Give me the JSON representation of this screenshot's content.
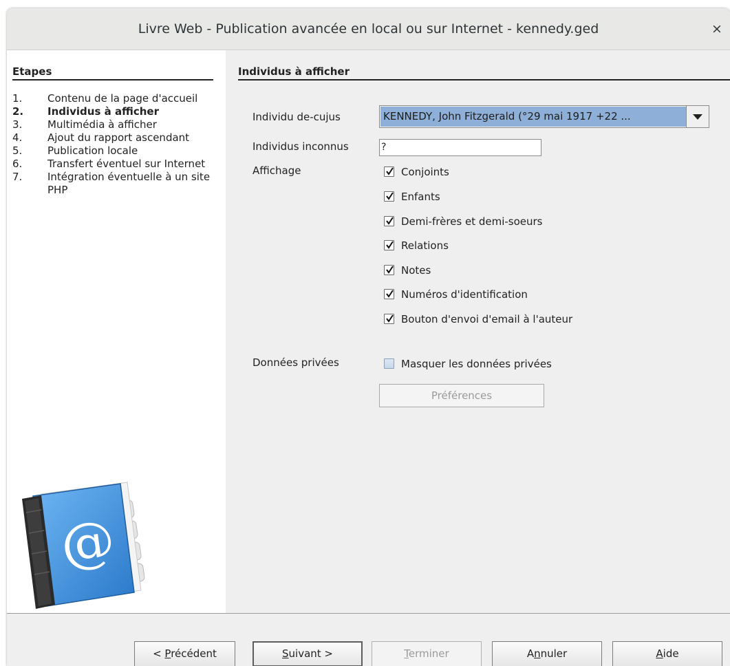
{
  "window": {
    "title": "Livre Web - Publication avancée en local ou sur Internet - kennedy.ged",
    "close_glyph": "×"
  },
  "steps": {
    "title": "Etapes",
    "items": [
      {
        "num": "1.",
        "label": "Contenu de la page d'accueil",
        "active": false
      },
      {
        "num": "2.",
        "label": "Individus à afficher",
        "active": true
      },
      {
        "num": "3.",
        "label": "Multimédia à afficher",
        "active": false
      },
      {
        "num": "4.",
        "label": "Ajout du rapport ascendant",
        "active": false
      },
      {
        "num": "5.",
        "label": "Publication locale",
        "active": false
      },
      {
        "num": "6.",
        "label": "Transfert éventuel sur Internet",
        "active": false
      },
      {
        "num": "7.",
        "label": "Intégration éventuelle à un site PHP",
        "active": false
      }
    ],
    "illustration_icon": "address-book-icon",
    "illustration_glyph": "@"
  },
  "section": {
    "title": "Individus à afficher",
    "decujus_label": "Individu de-cujus",
    "decujus_value": "KENNEDY, John Fitzgerald (°29 mai 1917 +22 ...",
    "inconnus_label": "Individus inconnus",
    "inconnus_value": "?",
    "affichage_label": "Affichage",
    "options": [
      {
        "label": "Conjoints",
        "checked": true
      },
      {
        "label": "Enfants",
        "checked": true
      },
      {
        "label": "Demi-frères et demi-soeurs",
        "checked": true
      },
      {
        "label": "Relations",
        "checked": true
      },
      {
        "label": "Notes",
        "checked": true
      },
      {
        "label": "Numéros d'identification",
        "checked": true
      },
      {
        "label": "Bouton d'envoi d'email à l'auteur",
        "checked": true
      }
    ],
    "privees_label": "Données privées",
    "masquer_label": "Masquer les données privées",
    "masquer_checked": false,
    "preferences_label": "Préférences"
  },
  "buttons": {
    "precedent": {
      "pre": "< ",
      "key": "P",
      "post": "récédent"
    },
    "suivant": {
      "pre": "",
      "key": "S",
      "post": "uivant >"
    },
    "terminer": {
      "pre": "",
      "key": "T",
      "post": "erminer"
    },
    "annuler": {
      "pre": "A",
      "key": "n",
      "post": "nuler"
    },
    "aide": {
      "pre": "",
      "key": "A",
      "post": "ide"
    }
  },
  "colors": {
    "selection": "#8eb0d8",
    "book_blue": "#3f8fe0"
  }
}
